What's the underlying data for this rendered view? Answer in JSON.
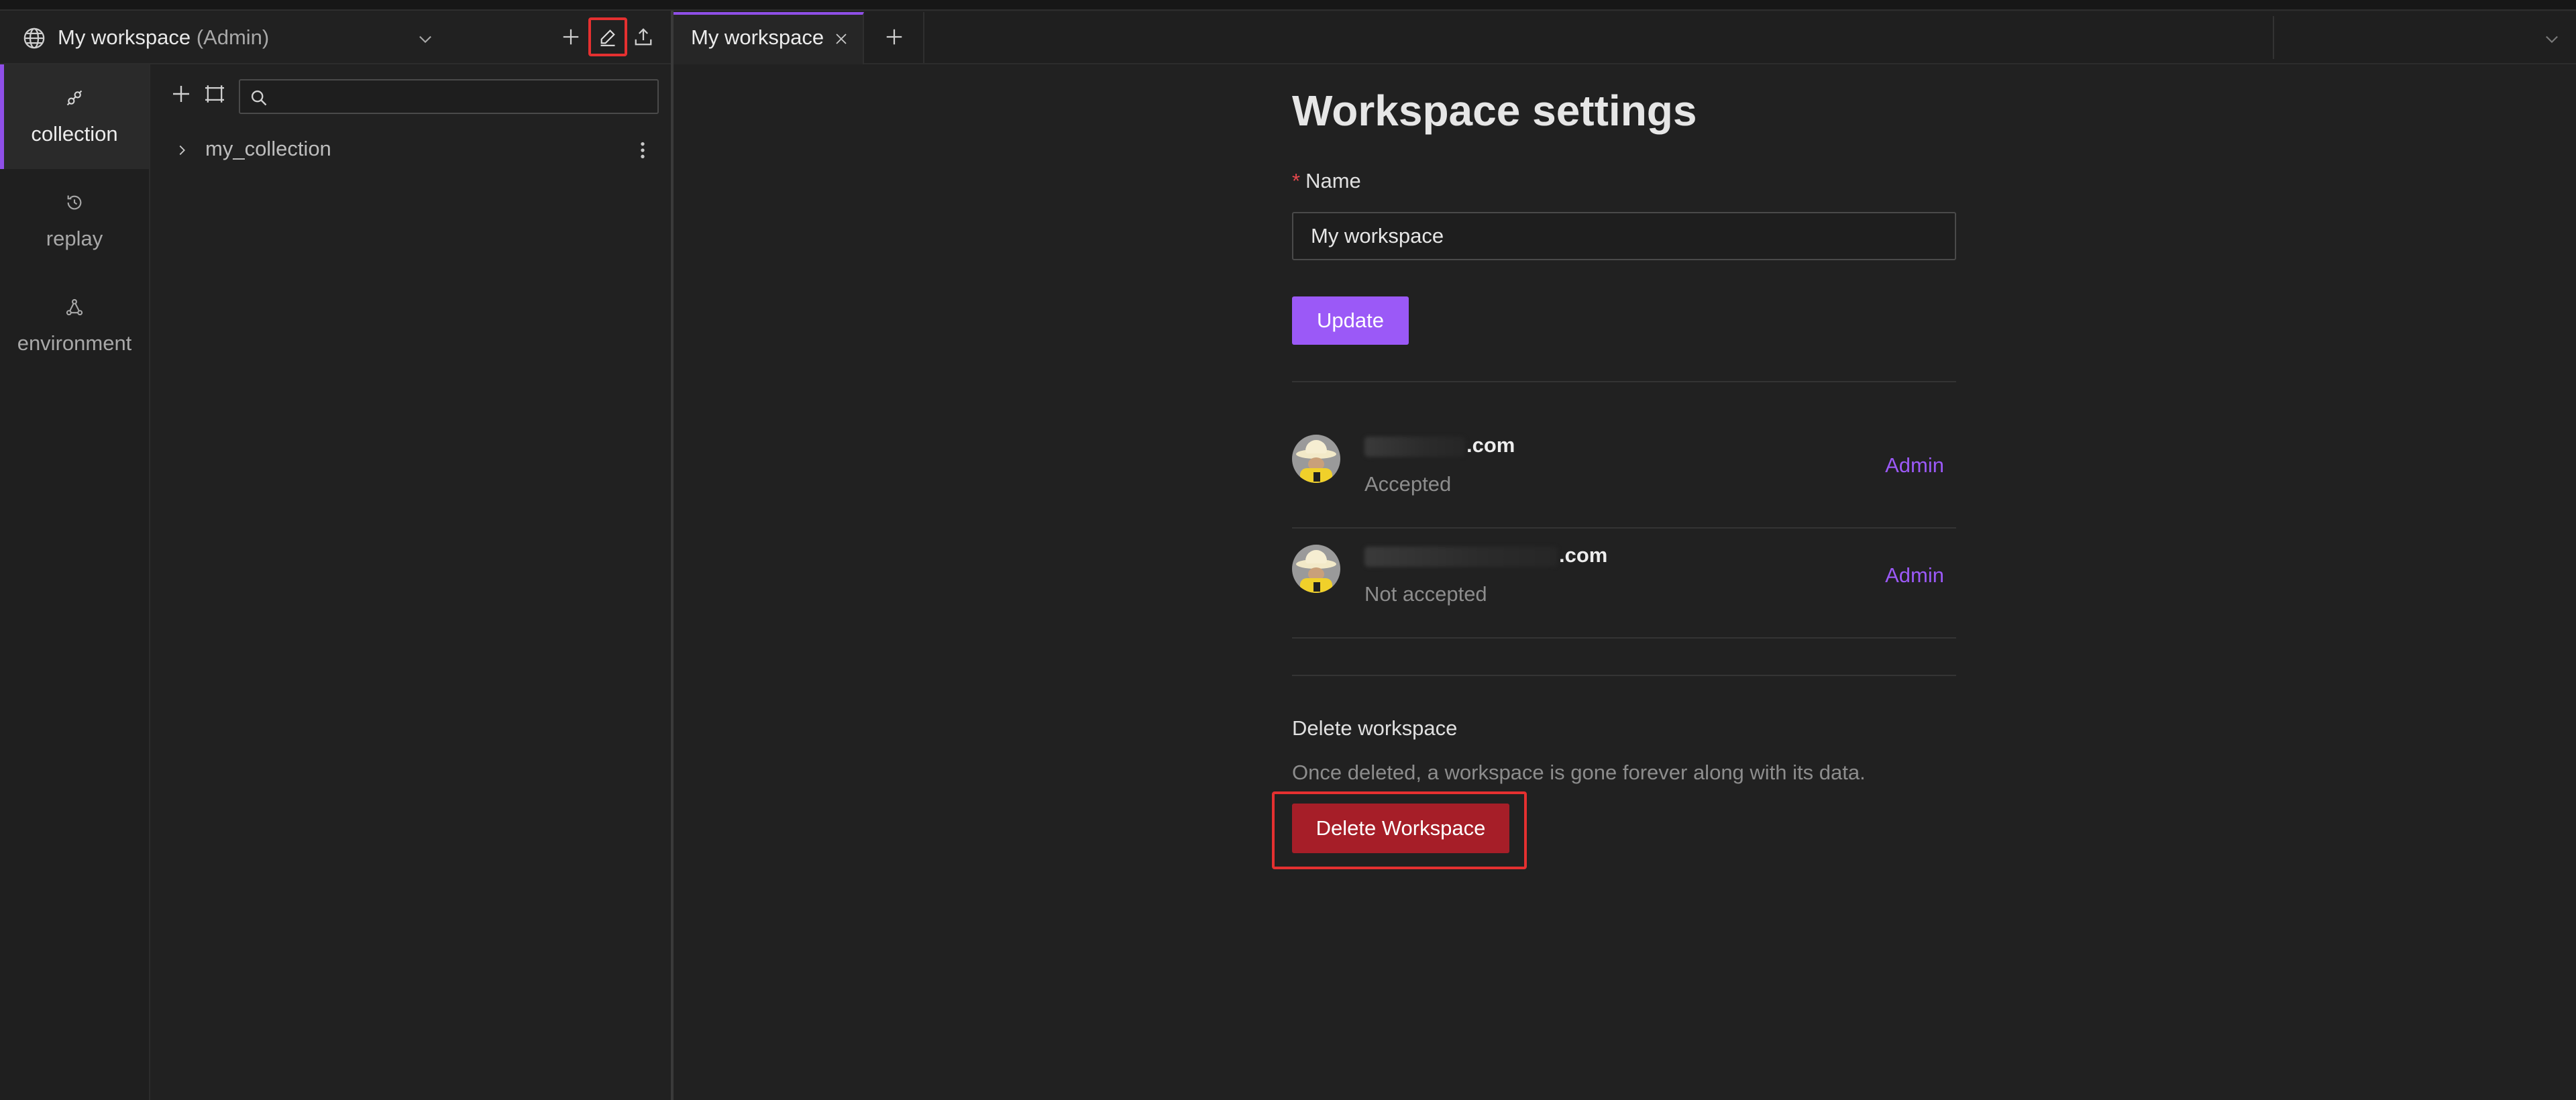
{
  "workspace_header": {
    "name": "My workspace",
    "role": "(Admin)"
  },
  "rail": {
    "items": [
      {
        "label": "collection",
        "icon": "collection-icon",
        "active": true
      },
      {
        "label": "replay",
        "icon": "replay-icon",
        "active": false
      },
      {
        "label": "environment",
        "icon": "environment-icon",
        "active": false
      }
    ]
  },
  "collections": {
    "search_placeholder": "",
    "items": [
      {
        "label": "my_collection"
      }
    ]
  },
  "tabs": [
    {
      "label": "My workspace",
      "active": true
    }
  ],
  "settings": {
    "title": "Workspace settings",
    "name_label": "Name",
    "required_marker": "*",
    "name_value": "My workspace",
    "update_label": "Update",
    "members": [
      {
        "email_visible": ".com",
        "status": "Accepted",
        "role": "Admin"
      },
      {
        "email_visible": ".com",
        "status": "Not accepted",
        "role": "Admin"
      }
    ],
    "delete_title": "Delete workspace",
    "delete_description": "Once deleted, a workspace is gone forever along with its data.",
    "delete_button": "Delete Workspace"
  },
  "colors": {
    "accent": "#9b59f7",
    "danger": "#a61e28",
    "highlight": "#e53030",
    "background": "#212121"
  }
}
